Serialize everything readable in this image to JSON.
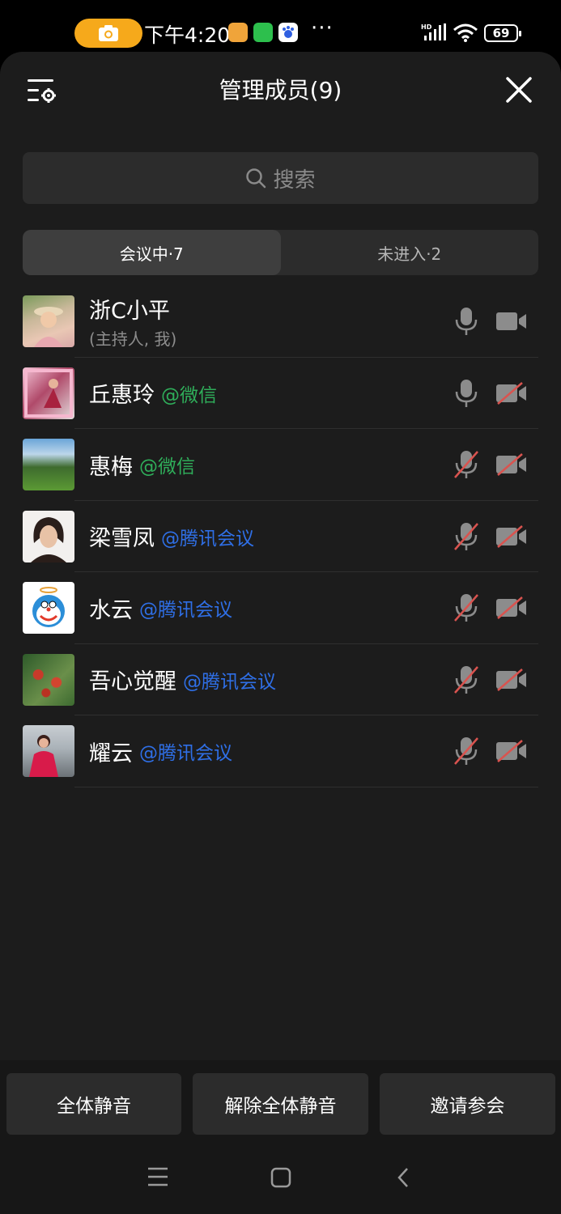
{
  "status_bar": {
    "time": "下午4:20",
    "more": "···",
    "battery": "69",
    "network": "HD"
  },
  "header": {
    "title": "管理成员(9)"
  },
  "search": {
    "placeholder": "搜索"
  },
  "tabs": [
    {
      "label": "会议中·7",
      "active": true
    },
    {
      "label": "未进入·2",
      "active": false
    }
  ],
  "members": [
    {
      "name": "浙C小平",
      "subtitle": "(主持人, 我)",
      "tag": "",
      "mic": "on",
      "camera": "on"
    },
    {
      "name": "丘惠玲",
      "tag": "@微信",
      "tag_type": "wechat",
      "mic": "on",
      "camera": "off"
    },
    {
      "name": "惠梅",
      "tag": "@微信",
      "tag_type": "wechat",
      "mic": "off",
      "camera": "off"
    },
    {
      "name": "梁雪凤",
      "tag": "@腾讯会议",
      "tag_type": "tencent",
      "mic": "off",
      "camera": "off"
    },
    {
      "name": "水云",
      "tag": "@腾讯会议",
      "tag_type": "tencent",
      "mic": "off",
      "camera": "off"
    },
    {
      "name": "吾心觉醒",
      "tag": "@腾讯会议",
      "tag_type": "tencent",
      "mic": "off",
      "camera": "off"
    },
    {
      "name": "耀云",
      "tag": "@腾讯会议",
      "tag_type": "tencent",
      "mic": "off",
      "camera": "off"
    }
  ],
  "footer": {
    "mute_all": "全体静音",
    "unmute_all": "解除全体静音",
    "invite": "邀请参会"
  },
  "colors": {
    "wechat_tag": "#2fae5a",
    "tencent_tag": "#2f6fe6",
    "muted_red": "#d9534f",
    "panel_bg": "#1c1c1c"
  }
}
